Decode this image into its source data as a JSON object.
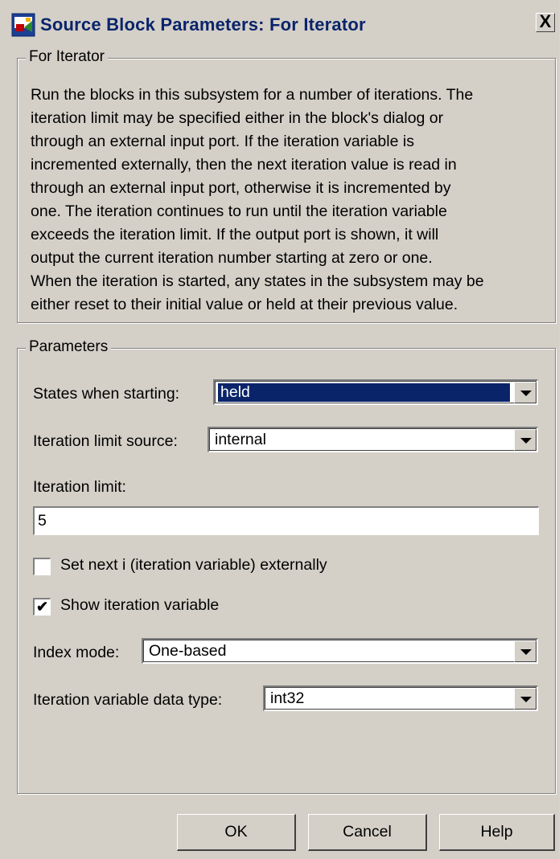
{
  "window": {
    "title": "Source Block Parameters: For Iterator",
    "close_label": "X"
  },
  "group_description": {
    "legend": "For Iterator",
    "lines": [
      "Run the blocks in this subsystem for a number of iterations.  The",
      "iteration limit may be specified either in the block's dialog or",
      "through an external input port.  If the iteration variable is",
      "incremented externally, then the next iteration value is read in",
      "through an external input port, otherwise it is incremented by",
      "one.  The iteration continues to run until the iteration variable",
      "exceeds the iteration limit.  If the output port is shown, it will",
      "output the current iteration number starting at zero or one.",
      "When the iteration is started, any states in the subsystem may be",
      "either reset to their initial value or held at their previous value."
    ]
  },
  "parameters": {
    "legend": "Parameters",
    "states_when_starting": {
      "label": "States when starting:",
      "value": "held"
    },
    "iteration_limit_source": {
      "label": "Iteration limit source:",
      "value": "internal"
    },
    "iteration_limit": {
      "label": "Iteration limit:",
      "value": "5"
    },
    "set_next_i": {
      "label": "Set next i (iteration variable) externally",
      "checked": false
    },
    "show_iteration_variable": {
      "label": "Show iteration variable",
      "checked": true,
      "mark": "✔"
    },
    "index_mode": {
      "label": "Index mode:",
      "value": "One-based"
    },
    "iteration_variable_data_type": {
      "label": "Iteration variable data type:",
      "value": "int32"
    }
  },
  "buttons": {
    "ok": "OK",
    "cancel": "Cancel",
    "help": "Help"
  }
}
